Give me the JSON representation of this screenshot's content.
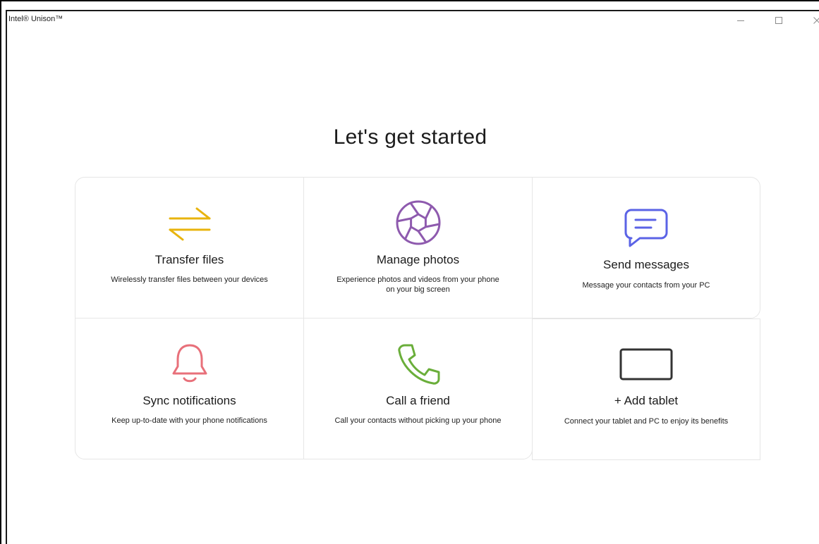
{
  "window": {
    "title": "Intel® Unison™",
    "minimize_glyph": "—",
    "maximize_glyph": "☐",
    "close_glyph": "✕"
  },
  "main": {
    "heading": "Let's get started"
  },
  "cards": [
    {
      "icon": "transfer-arrows-icon",
      "title": "Transfer files",
      "description": "Wirelessly transfer files between your devices",
      "color": "#E8B40E"
    },
    {
      "icon": "camera-aperture-icon",
      "title": "Manage photos",
      "description": "Experience photos and videos from your phone on your big screen",
      "color": "#8E5AAE"
    },
    {
      "icon": "message-bubble-icon",
      "title": "Send messages",
      "description": "Message your contacts from your PC",
      "color": "#5B63E6"
    },
    {
      "icon": "bell-icon",
      "title": "Sync notifications",
      "description": "Keep up-to-date with your phone notifications",
      "color": "#E8707A"
    },
    {
      "icon": "phone-icon",
      "title": "Call a friend",
      "description": "Call your contacts without picking up your phone",
      "color": "#6AAE3A"
    },
    {
      "icon": "tablet-icon",
      "title": "+ Add tablet",
      "description": "Connect your tablet and PC to enjoy its benefits",
      "color": "#333333"
    }
  ]
}
